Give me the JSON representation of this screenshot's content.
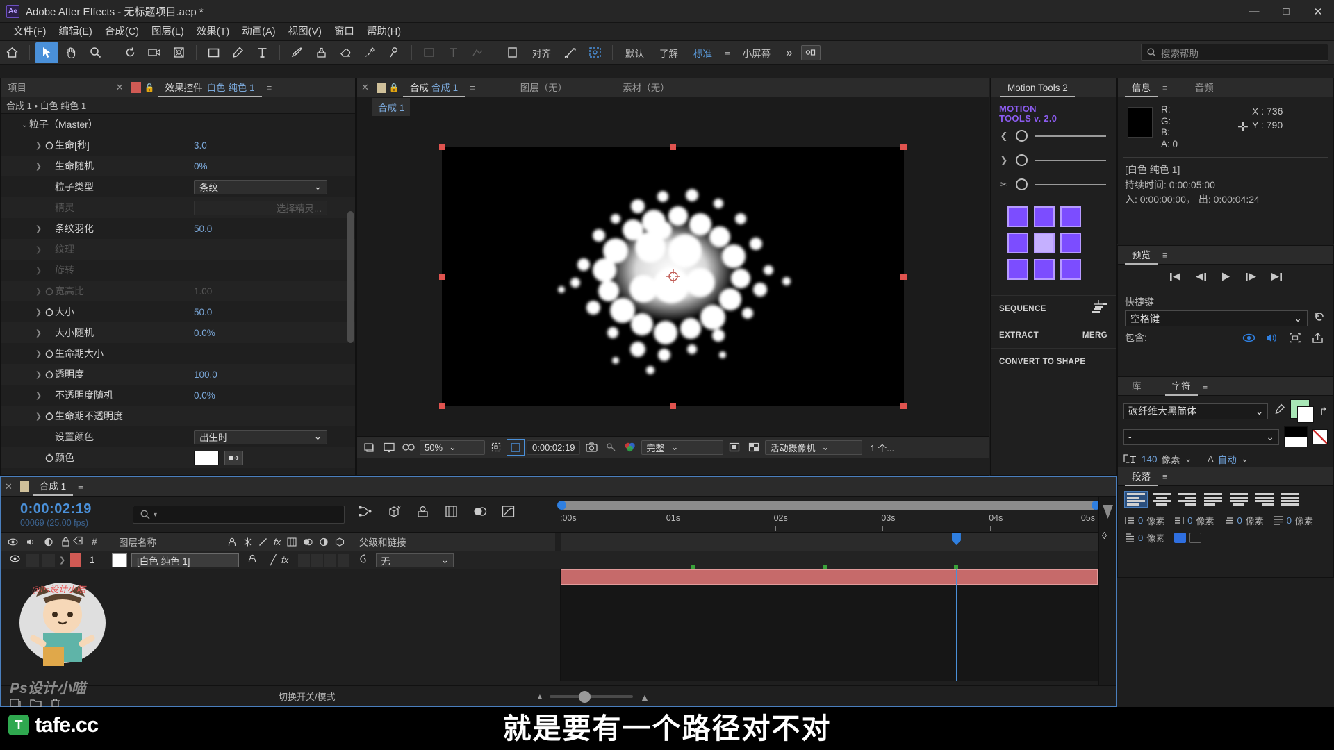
{
  "window": {
    "app_badge": "Ae",
    "title": "Adobe After Effects - 无标题项目.aep *",
    "minimize": "—",
    "maximize": "□",
    "close": "✕"
  },
  "menu": [
    "文件(F)",
    "编辑(E)",
    "合成(C)",
    "图层(L)",
    "效果(T)",
    "动画(A)",
    "视图(V)",
    "窗口",
    "帮助(H)"
  ],
  "toolbar": {
    "align_label": "对齐",
    "workspace_default": "默认",
    "workspace_learn": "了解",
    "workspace_standard": "标准",
    "workspace_small": "小屏幕",
    "overflow": "»",
    "search_placeholder": "搜索帮助"
  },
  "effect_controls": {
    "tab_project": "项目",
    "tab_title_prefix": "效果控件",
    "tab_title_layer": "白色 纯色 1",
    "breadcrumb": "合成 1 • 白色 纯色 1",
    "group_title": "粒子（Master）",
    "rows": [
      {
        "name": "生命[秒]",
        "value": "3.0",
        "indent": 2,
        "stopwatch": true,
        "arrow": true,
        "disabled": false,
        "type": "value"
      },
      {
        "name": "生命随机",
        "value": "0%",
        "indent": 2,
        "stopwatch": false,
        "arrow": true,
        "disabled": false,
        "type": "value"
      },
      {
        "name": "粒子类型",
        "value": "条纹",
        "indent": 2,
        "stopwatch": false,
        "arrow": false,
        "disabled": false,
        "type": "dropdown"
      },
      {
        "name": "精灵",
        "value": "选择精灵...",
        "indent": 2,
        "stopwatch": false,
        "arrow": false,
        "disabled": true,
        "type": "dropdown"
      },
      {
        "name": "条纹羽化",
        "value": "50.0",
        "indent": 2,
        "stopwatch": false,
        "arrow": true,
        "disabled": false,
        "type": "value"
      },
      {
        "name": "纹理",
        "value": "",
        "indent": 2,
        "stopwatch": false,
        "arrow": true,
        "disabled": true,
        "type": "value"
      },
      {
        "name": "旋转",
        "value": "",
        "indent": 2,
        "stopwatch": false,
        "arrow": true,
        "disabled": true,
        "type": "value"
      },
      {
        "name": "宽高比",
        "value": "1.00",
        "indent": 2,
        "stopwatch": true,
        "arrow": true,
        "disabled": true,
        "type": "value"
      },
      {
        "name": "大小",
        "value": "50.0",
        "indent": 2,
        "stopwatch": true,
        "arrow": true,
        "disabled": false,
        "type": "value"
      },
      {
        "name": "大小随机",
        "value": "0.0%",
        "indent": 2,
        "stopwatch": false,
        "arrow": true,
        "disabled": false,
        "type": "value"
      },
      {
        "name": "生命期大小",
        "value": "",
        "indent": 2,
        "stopwatch": true,
        "arrow": true,
        "disabled": false,
        "type": "value"
      },
      {
        "name": "透明度",
        "value": "100.0",
        "indent": 2,
        "stopwatch": true,
        "arrow": true,
        "disabled": false,
        "type": "value"
      },
      {
        "name": "不透明度随机",
        "value": "0.0%",
        "indent": 2,
        "stopwatch": false,
        "arrow": true,
        "disabled": false,
        "type": "value"
      },
      {
        "name": "生命期不透明度",
        "value": "",
        "indent": 2,
        "stopwatch": true,
        "arrow": true,
        "disabled": false,
        "type": "value"
      },
      {
        "name": "设置颜色",
        "value": "出生时",
        "indent": 2,
        "stopwatch": false,
        "arrow": false,
        "disabled": false,
        "type": "dropdown"
      },
      {
        "name": "颜色",
        "value": "",
        "indent": 2,
        "stopwatch": true,
        "arrow": false,
        "disabled": false,
        "type": "color"
      }
    ]
  },
  "composition": {
    "tab_comp_prefix": "合成",
    "tab_comp_name": "合成 1",
    "tab_layer": "图层（无）",
    "tab_footage": "素材（无）",
    "crumb": "合成 1",
    "bottom": {
      "zoom": "50%",
      "time": "0:00:02:19",
      "quality": "完整",
      "camera": "活动摄像机",
      "views": "1 个..."
    }
  },
  "motion_tools": {
    "tab": "Motion Tools 2",
    "logo_line1": "MOTION",
    "logo_line2": "TOOLS v. 2.0",
    "sequence": "SEQUENCE",
    "extract": "EXTRACT",
    "merge": "MERG",
    "convert": "CONVERT TO SHAPE"
  },
  "info": {
    "tab_info": "信息",
    "tab_audio": "音频",
    "r": "R:",
    "g": "G:",
    "b": "B:",
    "a": "A: 0",
    "x": "X : 736",
    "y": "Y : 790",
    "layer_name": "[白色 纯色 1]",
    "duration": "持续时间: 0:00:05:00",
    "inout": "入: 0:00:00:00， 出: 0:00:04:24"
  },
  "preview": {
    "tab": "预览",
    "shortcut_label": "快捷键",
    "shortcut_value": "空格键",
    "include_label": "包含:"
  },
  "character": {
    "tab_library": "库",
    "tab_character": "字符",
    "font_family": "碳纤维大黑简体",
    "font_style": "-",
    "size_value": "140",
    "size_unit": "像素",
    "leading_label": "A",
    "leading_value": "自动"
  },
  "paragraph": {
    "tab": "段落",
    "indents": [
      {
        "value": "0",
        "unit": "像素"
      },
      {
        "value": "0",
        "unit": "像素"
      },
      {
        "value": "0",
        "unit": "像素"
      },
      {
        "value": "0",
        "unit": "像素"
      },
      {
        "value": "0",
        "unit": "像素"
      },
      {
        "value": "0",
        "unit": "像素"
      }
    ]
  },
  "timeline": {
    "tab_name": "合成 1",
    "current_time": "0:00:02:19",
    "frame_info": "00069 (25.00 fps)",
    "search_placeholder": "",
    "columns": {
      "hash": "#",
      "layer_name": "图层名称",
      "parent": "父级和链接"
    },
    "ruler_labels": [
      ":00s",
      "01s",
      "02s",
      "03s",
      "04s",
      "05s"
    ],
    "layer": {
      "index": "1",
      "name": "[白色 纯色 1]",
      "parent": "无"
    },
    "switches_label": "切换开关/模式"
  },
  "overlay": {
    "watermark_text": "Ps设计小喵",
    "brand_icon": "T",
    "brand_text": "tafe.cc",
    "subtitle": "就是要有一个路径对不对"
  },
  "colors": {
    "accent_blue": "#4a90d9",
    "value_blue": "#7aa7d8",
    "panel_bg": "#1f1f1f",
    "tab_bg": "#2b2b2b",
    "clip_red": "#c66a6a",
    "motion_purple": "#7c4dff",
    "keyframe_green": "#3aa13a"
  }
}
